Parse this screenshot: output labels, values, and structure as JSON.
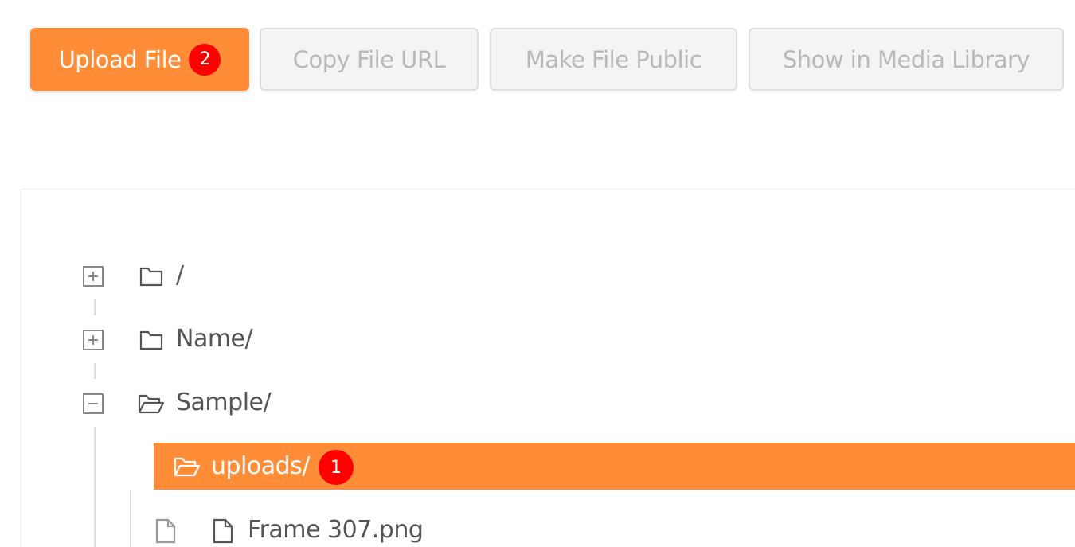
{
  "toolbar": {
    "upload_label": "Upload File",
    "upload_badge": "2",
    "copy_label": "Copy File URL",
    "public_label": "Make File Public",
    "library_label": "Show in Media Library"
  },
  "tree": {
    "items": [
      {
        "label": "/",
        "state": "collapsed",
        "icon": "folder-icon"
      },
      {
        "label": "Name/",
        "state": "collapsed",
        "icon": "folder-icon"
      },
      {
        "label": "Sample/",
        "state": "expanded",
        "icon": "folder-open-icon"
      },
      {
        "label": "uploads/",
        "state": "selected",
        "icon": "folder-open-icon",
        "badge": "1"
      },
      {
        "label": "Frame 307.png",
        "icon": "file-icon"
      }
    ]
  },
  "colors": {
    "accent": "#ff8c36",
    "badge": "#ff0000"
  }
}
